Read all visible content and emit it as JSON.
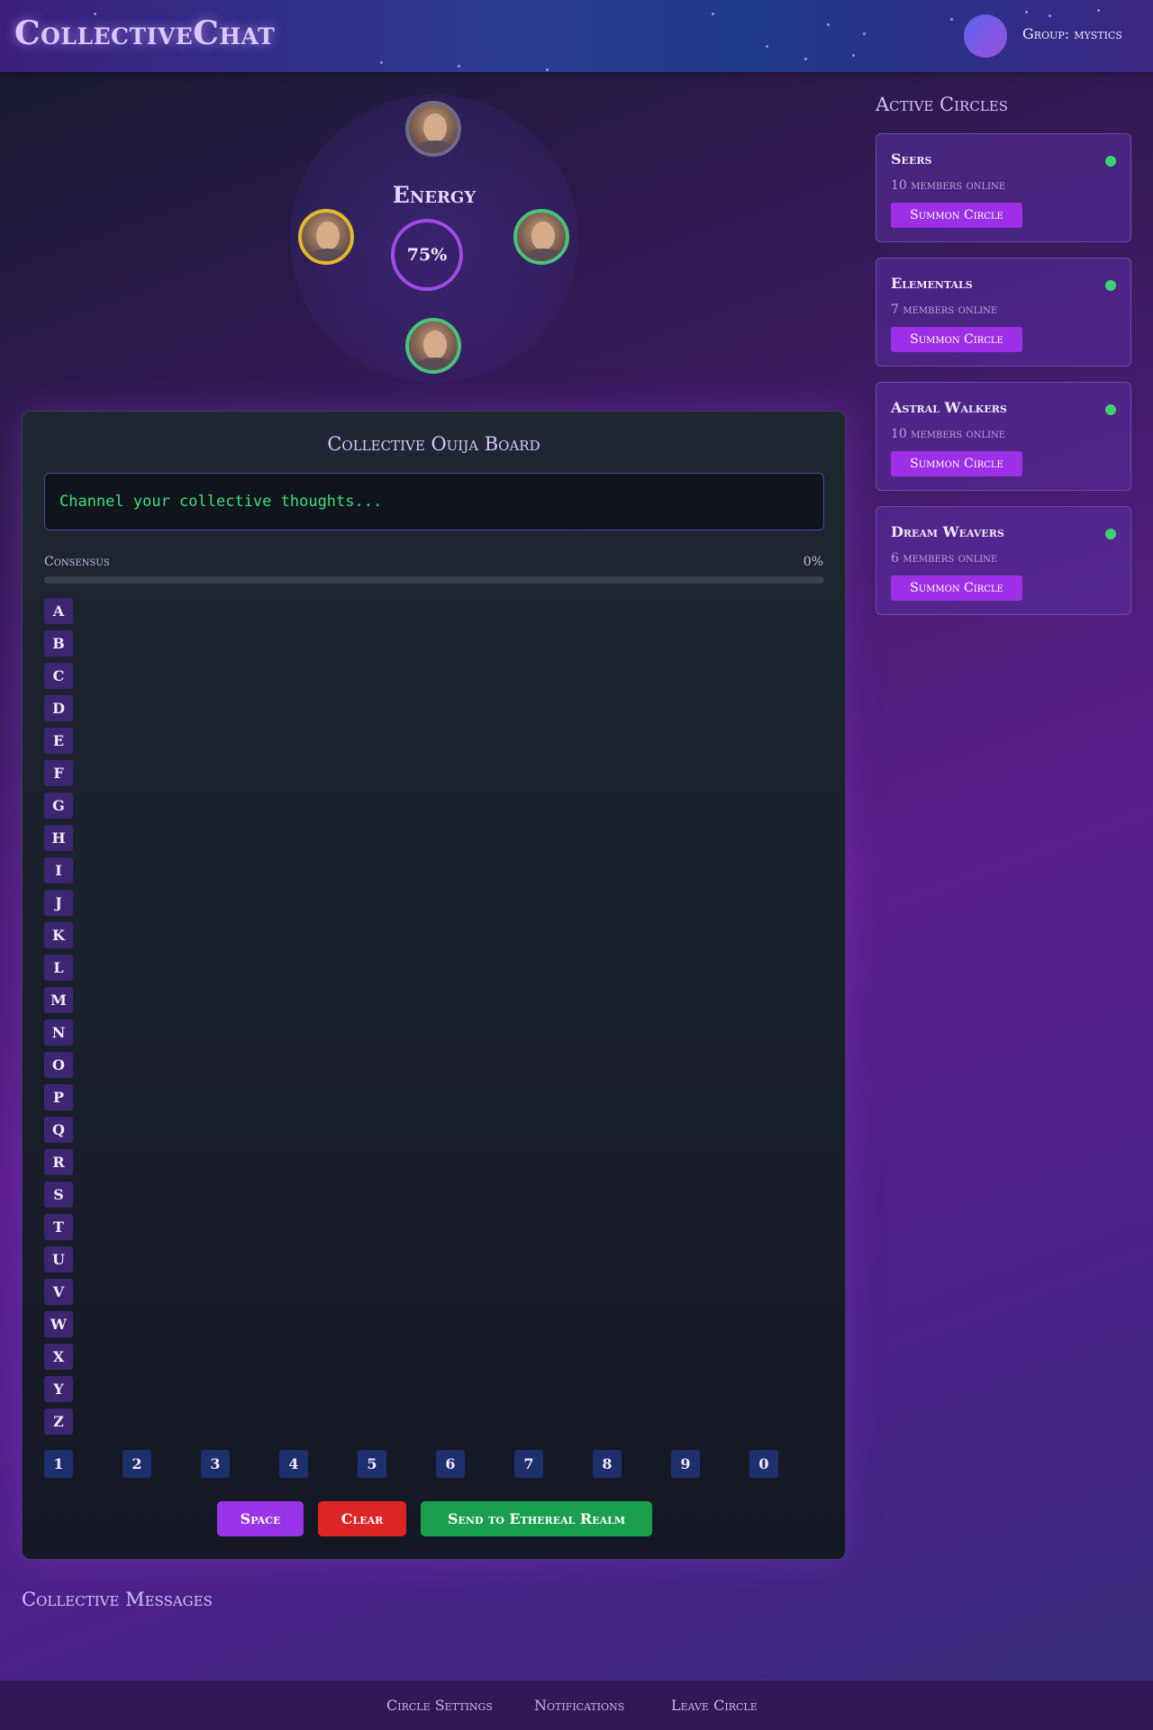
{
  "header": {
    "logo": "CollectiveChat",
    "group_label": "Group: mystics"
  },
  "energy": {
    "title": "Energy",
    "value": "75%",
    "members": [
      {
        "name": "member-top",
        "status": "gray"
      },
      {
        "name": "member-left",
        "status": "yellow"
      },
      {
        "name": "member-right",
        "status": "green"
      },
      {
        "name": "member-bottom",
        "status": "green"
      }
    ]
  },
  "board": {
    "title": "Collective Ouija Board",
    "input_placeholder": "Channel your collective thoughts...",
    "consensus_label": "Consensus",
    "consensus_value": "0%",
    "consensus_fraction": 0,
    "letters": [
      "A",
      "B",
      "C",
      "D",
      "E",
      "F",
      "G",
      "H",
      "I",
      "J",
      "K",
      "L",
      "M",
      "N",
      "O",
      "P",
      "Q",
      "R",
      "S",
      "T",
      "U",
      "V",
      "W",
      "X",
      "Y",
      "Z"
    ],
    "numbers": [
      "1",
      "2",
      "3",
      "4",
      "5",
      "6",
      "7",
      "8",
      "9",
      "0"
    ],
    "space_label": "Space",
    "clear_label": "Clear",
    "send_label": "Send to Ethereal Realm"
  },
  "circles": {
    "title": "Active Circles",
    "items": [
      {
        "name": "Seers",
        "count": "10 members online",
        "action": "Summon Circle"
      },
      {
        "name": "Elementals",
        "count": "7 members online",
        "action": "Summon Circle"
      },
      {
        "name": "Astral Walkers",
        "count": "10 members online",
        "action": "Summon Circle"
      },
      {
        "name": "Dream Weavers",
        "count": "6 members online",
        "action": "Summon Circle"
      }
    ]
  },
  "messages": {
    "title": "Collective Messages"
  },
  "footer": {
    "links": [
      "Circle Settings",
      "Notifications",
      "Leave Circle"
    ]
  },
  "colors": {
    "accent": "#9b34e8",
    "online": "#3fcf73",
    "danger": "#dd2525",
    "success": "#1aa04c",
    "terminal_text": "#3ee07a"
  }
}
